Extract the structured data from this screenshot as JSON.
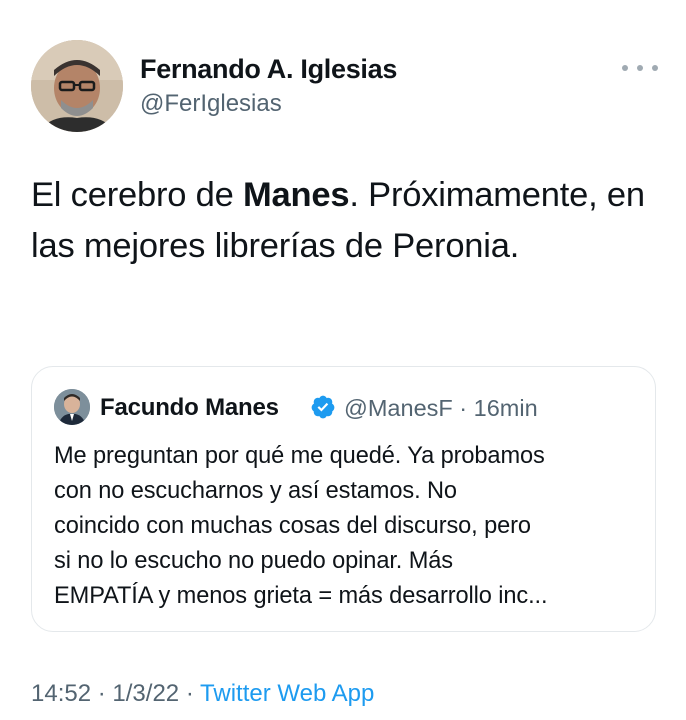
{
  "author": {
    "name": "Fernando A. Iglesias",
    "handle": "@FerIglesias"
  },
  "more_icon": "ellipsis-horizontal-icon",
  "tweet": {
    "text_before": "El cerebro de ",
    "text_bold": "Manes",
    "text_after": ". Próximamente, en las mejores librerías de Peronia."
  },
  "quote": {
    "name": "Facundo Manes",
    "verified_icon": "verified-badge-icon",
    "handle": "@ManesF",
    "separator": "·",
    "time": "16min",
    "lines": [
      "Me preguntan por qué me quedé. Ya probamos",
      "con no escucharnos y así estamos. No",
      "coincido con muchas cosas del discurso, pero",
      "si no lo escucho no puedo opinar. Más",
      "EMPATÍA y menos grieta = más desarrollo inc..."
    ]
  },
  "footer": {
    "time": "14:52",
    "sep1": "·",
    "date": "1/3/22",
    "sep2": "·",
    "app": "Twitter Web App"
  },
  "colors": {
    "link": "#1d9bf0",
    "secondary_text": "#536471",
    "border": "#e4e8eb"
  }
}
